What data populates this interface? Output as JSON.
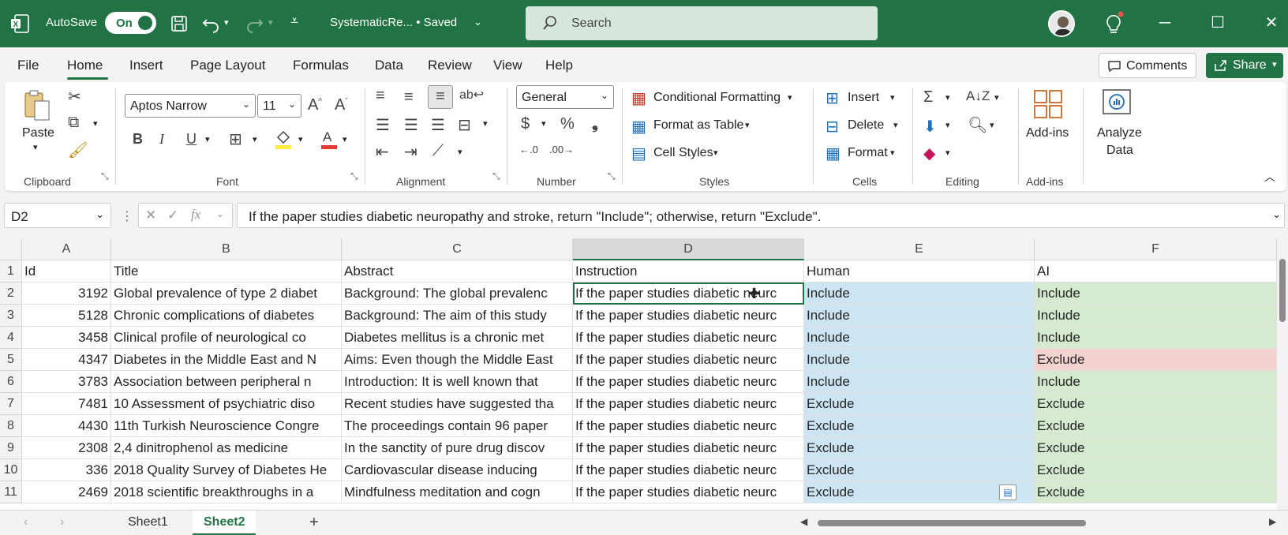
{
  "titlebar": {
    "autosave_label": "AutoSave",
    "autosave_state": "On",
    "doc_title": "SystematicRe... • Saved",
    "search_placeholder": "Search"
  },
  "tabs": [
    "File",
    "Home",
    "Insert",
    "Page Layout",
    "Formulas",
    "Data",
    "Review",
    "View",
    "Help"
  ],
  "active_tab": "Home",
  "buttons": {
    "comments": "Comments",
    "share": "Share"
  },
  "ribbon": {
    "clipboard": {
      "paste": "Paste",
      "label": "Clipboard"
    },
    "font": {
      "name": "Aptos Narrow",
      "size": "11",
      "label": "Font"
    },
    "alignment": {
      "label": "Alignment"
    },
    "number": {
      "format": "General",
      "label": "Number",
      "currency": "$",
      "percent": "%"
    },
    "styles": {
      "conditional": "Conditional Formatting",
      "table": "Format as Table",
      "cell_styles": "Cell Styles",
      "label": "Styles"
    },
    "cells": {
      "insert": "Insert",
      "delete": "Delete",
      "format": "Format",
      "label": "Cells"
    },
    "editing": {
      "label": "Editing"
    },
    "addins": {
      "addins": "Add-ins",
      "label": "Add-ins"
    },
    "analyze": {
      "line1": "Analyze",
      "line2": "Data"
    }
  },
  "formula_bar": {
    "cell_ref": "D2",
    "formula": "If the paper studies diabetic neuropathy and stroke, return \"Include\"; otherwise, return \"Exclude\"."
  },
  "columns": [
    "A",
    "B",
    "C",
    "D",
    "E",
    "F"
  ],
  "header_row": [
    "Id",
    "Title",
    "Abstract",
    "Instruction",
    "Human",
    "AI"
  ],
  "rows": [
    {
      "n": "2",
      "id": "3192",
      "title": "Global prevalence of type 2 diabet",
      "abstract": "Background: The global prevalenc",
      "instr": "If the paper studies diabetic neurc",
      "human": "Include",
      "ai": "Include",
      "match": true
    },
    {
      "n": "3",
      "id": "5128",
      "title": "Chronic complications of diabetes",
      "abstract": "Background: The aim of this study",
      "instr": "If the paper studies diabetic neurc",
      "human": "Include",
      "ai": "Include",
      "match": true
    },
    {
      "n": "4",
      "id": "3458",
      "title": "Clinical profile of neurological co",
      "abstract": "Diabetes mellitus is a chronic met",
      "instr": "If the paper studies diabetic neurc",
      "human": "Include",
      "ai": "Include",
      "match": true
    },
    {
      "n": "5",
      "id": "4347",
      "title": "Diabetes in the Middle East and N",
      "abstract": "Aims: Even though the Middle East",
      "instr": "If the paper studies diabetic neurc",
      "human": "Include",
      "ai": "Exclude",
      "match": false
    },
    {
      "n": "6",
      "id": "3783",
      "title": "Association between peripheral n",
      "abstract": "Introduction: It is well known that",
      "instr": "If the paper studies diabetic neurc",
      "human": "Include",
      "ai": "Include",
      "match": true
    },
    {
      "n": "7",
      "id": "7481",
      "title": "10 Assessment of psychiatric diso",
      "abstract": "Recent studies have suggested tha",
      "instr": "If the paper studies diabetic neurc",
      "human": "Exclude",
      "ai": "Exclude",
      "match": true
    },
    {
      "n": "8",
      "id": "4430",
      "title": "11th Turkish Neuroscience Congre",
      "abstract": "The proceedings contain 96 paper",
      "instr": "If the paper studies diabetic neurc",
      "human": "Exclude",
      "ai": "Exclude",
      "match": true
    },
    {
      "n": "9",
      "id": "2308",
      "title": "2,4 dinitrophenol as medicine",
      "abstract": "In the sanctity of pure drug discov",
      "instr": "If the paper studies diabetic neurc",
      "human": "Exclude",
      "ai": "Exclude",
      "match": true
    },
    {
      "n": "10",
      "id": "336",
      "title": "2018 Quality Survey of Diabetes He",
      "abstract": "Cardiovascular disease inducing",
      "instr": "If the paper studies diabetic neurc",
      "human": "Exclude",
      "ai": "Exclude",
      "match": true
    },
    {
      "n": "11",
      "id": "2469",
      "title": "2018 scientific breakthroughs in a",
      "abstract": "Mindfulness meditation and cogn",
      "instr": "If the paper studies diabetic neurc",
      "human": "Exclude",
      "ai": "Exclude",
      "match": true
    }
  ],
  "sheets": [
    "Sheet1",
    "Sheet2"
  ],
  "active_sheet": "Sheet2",
  "colors": {
    "brand": "#217346",
    "human_fill": "#cde4f3",
    "match_fill": "#d5ead0",
    "mismatch_fill": "#f3d2cf"
  }
}
